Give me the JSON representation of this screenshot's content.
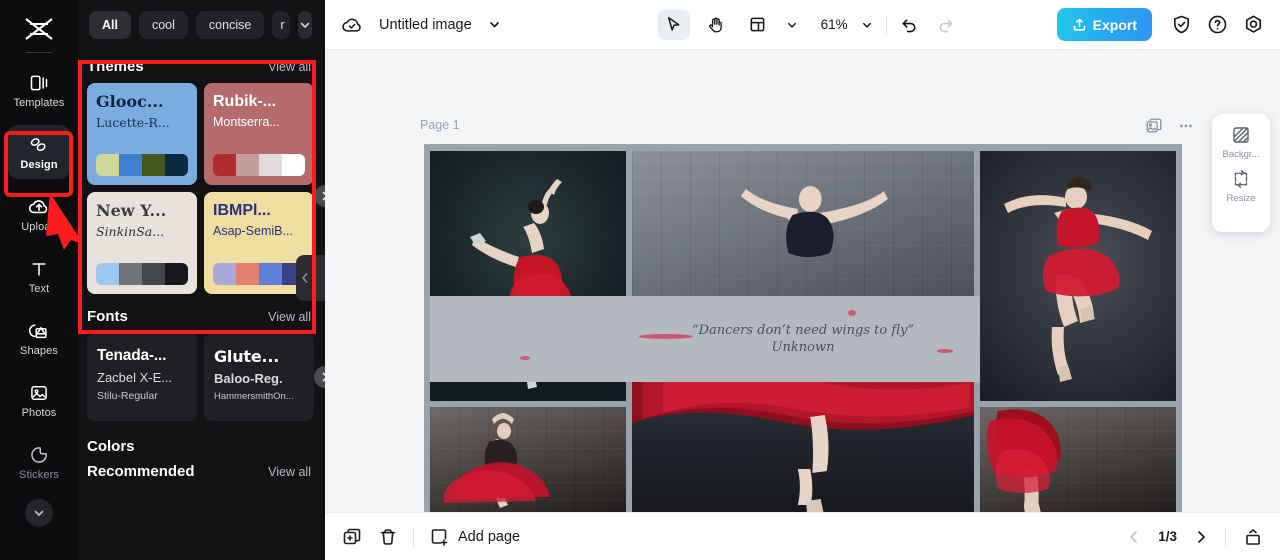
{
  "rail": {
    "logo_icon": "capcut-logo-icon",
    "items": [
      {
        "label": "Templates",
        "icon": "templates-icon",
        "active": false,
        "dim": false
      },
      {
        "label": "Design",
        "icon": "design-icon",
        "active": true,
        "dim": false
      },
      {
        "label": "Upload",
        "icon": "upload-cloud-icon",
        "active": false,
        "dim": false
      },
      {
        "label": "Text",
        "icon": "text-t-icon",
        "active": false,
        "dim": false
      },
      {
        "label": "Shapes",
        "icon": "shapes-icon",
        "active": false,
        "dim": false
      },
      {
        "label": "Photos",
        "icon": "photos-image-icon",
        "active": false,
        "dim": false
      },
      {
        "label": "Stickers",
        "icon": "stickers-icon",
        "active": false,
        "dim": true
      }
    ],
    "more_icon": "chevron-down-icon"
  },
  "annotations": {
    "highlight_color": "#fc1c1c",
    "arrow_icon": "red-arrow-pointer"
  },
  "panel": {
    "filters": [
      {
        "label": "All",
        "selected": true
      },
      {
        "label": "cool",
        "selected": false
      },
      {
        "label": "concise",
        "selected": false
      },
      {
        "label": "r",
        "selected": false,
        "clipped": true
      }
    ],
    "filters_expand_icon": "chevron-down-icon",
    "themes": {
      "title": "Themes",
      "view_all": "View all",
      "next_icon": "chevron-right-icon",
      "cards": [
        {
          "title": "Glooc...",
          "subtitle": "Lucette-R...",
          "bg": "#7bace0",
          "title_color": "#10223c",
          "sub_color": "#17304f",
          "title_font": "serif",
          "sub_font": "serif",
          "swatches": [
            "#cdd89a",
            "#3f7fd0",
            "#44571f",
            "#0b2b42"
          ]
        },
        {
          "title": "Rubik-...",
          "subtitle": "Montserra...",
          "bg": "#b56b6b",
          "title_color": "#ffffff",
          "sub_color": "#ffffff",
          "title_font": "sans",
          "sub_font": "sans",
          "swatches": [
            "#b22b2f",
            "#c49d9d",
            "#e3dada",
            "#ffffff"
          ]
        },
        {
          "title": "New Y...",
          "subtitle": "SinkinSa...",
          "bg": "#e6e3dd",
          "title_color": "#3c3c3c",
          "sub_color": "#2f2f2f",
          "title_font": "serif",
          "sub_font": "serif-italic",
          "swatches": [
            "#9cc8ef",
            "#6f7377",
            "#43464a",
            "#18181a"
          ]
        },
        {
          "title": "IBMPl...",
          "subtitle": "Asap-SemiB...",
          "bg": "#f0dda1",
          "title_color": "#2b3279",
          "sub_color": "#2b3279",
          "title_font": "sans-bold",
          "sub_font": "sans-bold",
          "swatches": [
            "#a8a8d9",
            "#e08172",
            "#5f7fda",
            "#3b3f85"
          ]
        }
      ]
    },
    "fonts": {
      "title": "Fonts",
      "view_all": "View all",
      "next_icon": "chevron-right-icon",
      "cards": [
        {
          "line1": "Tenada-...",
          "line2": "Zacbel X-E...",
          "line3": "Stilu-Regular",
          "style": "a"
        },
        {
          "line1": "Glute...",
          "line2": "Baloo-Reg.",
          "line3": "HammersmithOn...",
          "style": "b"
        }
      ]
    },
    "colors": {
      "title": "Colors",
      "recommended": "Recommended",
      "view_all": "View all"
    },
    "flyout_icon": "chevron-left-icon"
  },
  "topbar": {
    "cloud_saved_icon": "cloud-check-icon",
    "doc_title": "Untitled image",
    "doc_dropdown_icon": "chevron-down-icon",
    "select_tool_icon": "cursor-select-icon",
    "hand_tool_icon": "hand-pan-icon",
    "layout_tool_icon": "layout-grid-icon",
    "layout_dropdown_icon": "chevron-down-icon",
    "zoom": "61%",
    "zoom_dropdown_icon": "chevron-down-icon",
    "undo_icon": "undo-arrow-icon",
    "redo_icon": "redo-arrow-icon",
    "export_label": "Export",
    "export_icon": "upload-share-icon",
    "export_color": "#24b6ec",
    "shield_icon": "shield-check-icon",
    "help_icon": "help-question-icon",
    "settings_icon": "settings-gear-icon"
  },
  "canvas": {
    "page_label": "Page 1",
    "duplicate_page_icon": "duplicate-image-icon",
    "more_options_icon": "more-dots-icon",
    "background_color": "#98a3ab",
    "quote": {
      "line1": "“Dancers don’t need wings to fly”",
      "line2": "Unknown"
    },
    "photos": [
      {
        "name": "ballerina-arabesque-teal"
      },
      {
        "name": "ballerina-red-skirt-wall"
      },
      {
        "name": "ballerina-grunge-wall-top"
      },
      {
        "name": "ballerina-red-fabric-bottom"
      },
      {
        "name": "ballerina-leap-grey"
      },
      {
        "name": "ballerina-red-dress-brick"
      }
    ]
  },
  "float_panel": {
    "items": [
      {
        "label": "Backgr...",
        "icon": "background-pattern-icon"
      },
      {
        "label": "Resize",
        "icon": "resize-arrows-icon"
      }
    ]
  },
  "bottombar": {
    "duplicate_icon": "duplicate-page-icon",
    "delete_icon": "trash-delete-icon",
    "add_page_label": "Add page",
    "add_page_icon": "add-page-plus-icon",
    "prev_icon": "chevron-left-icon",
    "page_indicator": "1/3",
    "next_icon": "chevron-right-icon",
    "expand_icon": "expand-tray-icon"
  }
}
